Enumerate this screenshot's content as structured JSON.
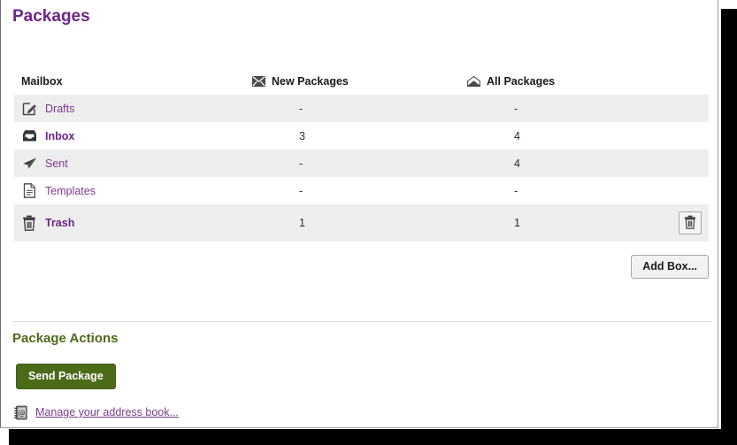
{
  "page": {
    "title": "Packages"
  },
  "table": {
    "headers": {
      "mailbox": "Mailbox",
      "new_packages": "New Packages",
      "all_packages": "All Packages",
      "new_icon": "closed-envelope-icon",
      "all_icon": "open-envelope-icon"
    },
    "rows": [
      {
        "icon": "drafts-pencil-icon",
        "label": "Drafts",
        "new": "-",
        "all": "-",
        "unread": false,
        "striped": true,
        "has_empty_button": false
      },
      {
        "icon": "inbox-tray-icon",
        "label": "Inbox",
        "new": "3",
        "all": "4",
        "unread": true,
        "striped": false,
        "has_empty_button": false
      },
      {
        "icon": "sent-paper-plane-icon",
        "label": "Sent",
        "new": "-",
        "all": "4",
        "unread": false,
        "striped": true,
        "has_empty_button": false
      },
      {
        "icon": "templates-document-icon",
        "label": "Templates",
        "new": "-",
        "all": "-",
        "unread": false,
        "striped": false,
        "has_empty_button": false
      },
      {
        "icon": "trash-can-icon",
        "label": "Trash",
        "new": "1",
        "all": "1",
        "unread": true,
        "striped": true,
        "has_empty_button": true,
        "empty_button_icon": "trash-can-icon"
      }
    ],
    "add_box_label": "Add Box..."
  },
  "actions": {
    "section_title": "Package Actions",
    "send_package_label": "Send Package",
    "address_book_icon": "address-book-icon",
    "address_book_label": "Manage your address book..."
  },
  "colors": {
    "title_purple": "#6e2585",
    "link_purple": "#7b3a8c",
    "action_green": "#4c6b18",
    "row_stripe": "#eeeeee",
    "divider": "#dcdcdc"
  }
}
